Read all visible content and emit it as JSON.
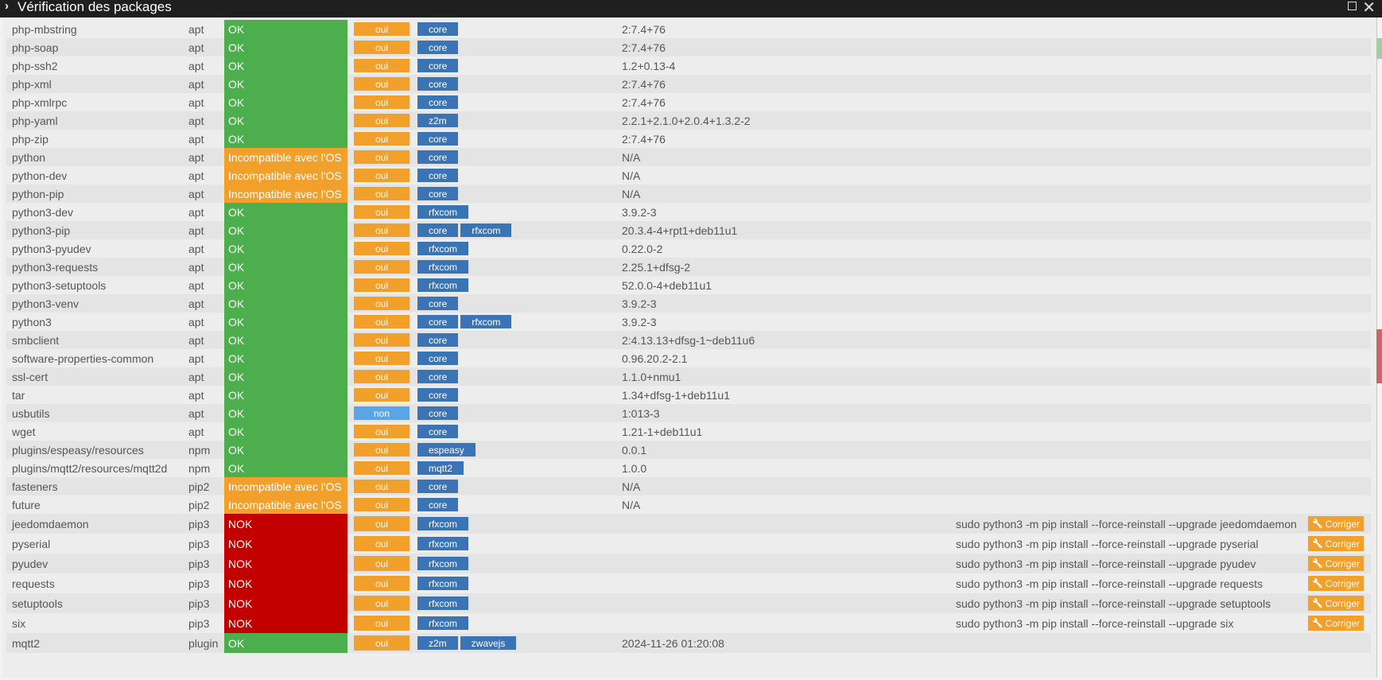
{
  "window": {
    "title": "Vérification des packages"
  },
  "fix_label": "Corriger",
  "colors": {
    "ok": "#4cae4c",
    "warn": "#f0a02b",
    "nok": "#c30000",
    "tag": "#3a74b4",
    "non": "#5aa5e6"
  },
  "rows": [
    {
      "name": "php-mbstring",
      "type": "apt",
      "status": "OK",
      "status_kind": "ok",
      "required": "oui",
      "tags": [
        "core"
      ],
      "version": "2:7.4+76",
      "command": ""
    },
    {
      "name": "php-soap",
      "type": "apt",
      "status": "OK",
      "status_kind": "ok",
      "required": "oui",
      "tags": [
        "core"
      ],
      "version": "2:7.4+76",
      "command": ""
    },
    {
      "name": "php-ssh2",
      "type": "apt",
      "status": "OK",
      "status_kind": "ok",
      "required": "oui",
      "tags": [
        "core"
      ],
      "version": "1.2+0.13-4",
      "command": ""
    },
    {
      "name": "php-xml",
      "type": "apt",
      "status": "OK",
      "status_kind": "ok",
      "required": "oui",
      "tags": [
        "core"
      ],
      "version": "2:7.4+76",
      "command": ""
    },
    {
      "name": "php-xmlrpc",
      "type": "apt",
      "status": "OK",
      "status_kind": "ok",
      "required": "oui",
      "tags": [
        "core"
      ],
      "version": "2:7.4+76",
      "command": ""
    },
    {
      "name": "php-yaml",
      "type": "apt",
      "status": "OK",
      "status_kind": "ok",
      "required": "oui",
      "tags": [
        "z2m"
      ],
      "version": "2.2.1+2.1.0+2.0.4+1.3.2-2",
      "command": ""
    },
    {
      "name": "php-zip",
      "type": "apt",
      "status": "OK",
      "status_kind": "ok",
      "required": "oui",
      "tags": [
        "core"
      ],
      "version": "2:7.4+76",
      "command": ""
    },
    {
      "name": "python",
      "type": "apt",
      "status": "Incompatible avec l'OS",
      "status_kind": "warn",
      "required": "oui",
      "tags": [
        "core"
      ],
      "version": "N/A",
      "command": ""
    },
    {
      "name": "python-dev",
      "type": "apt",
      "status": "Incompatible avec l'OS",
      "status_kind": "warn",
      "required": "oui",
      "tags": [
        "core"
      ],
      "version": "N/A",
      "command": ""
    },
    {
      "name": "python-pip",
      "type": "apt",
      "status": "Incompatible avec l'OS",
      "status_kind": "warn",
      "required": "oui",
      "tags": [
        "core"
      ],
      "version": "N/A",
      "command": ""
    },
    {
      "name": "python3-dev",
      "type": "apt",
      "status": "OK",
      "status_kind": "ok",
      "required": "oui",
      "tags": [
        "rfxcom"
      ],
      "version": "3.9.2-3",
      "command": ""
    },
    {
      "name": "python3-pip",
      "type": "apt",
      "status": "OK",
      "status_kind": "ok",
      "required": "oui",
      "tags": [
        "core",
        "rfxcom"
      ],
      "version": "20.3.4-4+rpt1+deb11u1",
      "command": ""
    },
    {
      "name": "python3-pyudev",
      "type": "apt",
      "status": "OK",
      "status_kind": "ok",
      "required": "oui",
      "tags": [
        "rfxcom"
      ],
      "version": "0.22.0-2",
      "command": ""
    },
    {
      "name": "python3-requests",
      "type": "apt",
      "status": "OK",
      "status_kind": "ok",
      "required": "oui",
      "tags": [
        "rfxcom"
      ],
      "version": "2.25.1+dfsg-2",
      "command": ""
    },
    {
      "name": "python3-setuptools",
      "type": "apt",
      "status": "OK",
      "status_kind": "ok",
      "required": "oui",
      "tags": [
        "rfxcom"
      ],
      "version": "52.0.0-4+deb11u1",
      "command": ""
    },
    {
      "name": "python3-venv",
      "type": "apt",
      "status": "OK",
      "status_kind": "ok",
      "required": "oui",
      "tags": [
        "core"
      ],
      "version": "3.9.2-3",
      "command": ""
    },
    {
      "name": "python3",
      "type": "apt",
      "status": "OK",
      "status_kind": "ok",
      "required": "oui",
      "tags": [
        "core",
        "rfxcom"
      ],
      "version": "3.9.2-3",
      "command": ""
    },
    {
      "name": "smbclient",
      "type": "apt",
      "status": "OK",
      "status_kind": "ok",
      "required": "oui",
      "tags": [
        "core"
      ],
      "version": "2:4.13.13+dfsg-1~deb11u6",
      "command": ""
    },
    {
      "name": "software-properties-common",
      "type": "apt",
      "status": "OK",
      "status_kind": "ok",
      "required": "oui",
      "tags": [
        "core"
      ],
      "version": "0.96.20.2-2.1",
      "command": ""
    },
    {
      "name": "ssl-cert",
      "type": "apt",
      "status": "OK",
      "status_kind": "ok",
      "required": "oui",
      "tags": [
        "core"
      ],
      "version": "1.1.0+nmu1",
      "command": ""
    },
    {
      "name": "tar",
      "type": "apt",
      "status": "OK",
      "status_kind": "ok",
      "required": "oui",
      "tags": [
        "core"
      ],
      "version": "1.34+dfsg-1+deb11u1",
      "command": ""
    },
    {
      "name": "usbutils",
      "type": "apt",
      "status": "OK",
      "status_kind": "ok",
      "required": "non",
      "tags": [
        "core"
      ],
      "version": "1:013-3",
      "command": ""
    },
    {
      "name": "wget",
      "type": "apt",
      "status": "OK",
      "status_kind": "ok",
      "required": "oui",
      "tags": [
        "core"
      ],
      "version": "1.21-1+deb11u1",
      "command": ""
    },
    {
      "name": "plugins/espeasy/resources",
      "type": "npm",
      "status": "OK",
      "status_kind": "ok",
      "required": "oui",
      "tags": [
        "espeasy"
      ],
      "version": "0.0.1",
      "command": ""
    },
    {
      "name": "plugins/mqtt2/resources/mqtt2d",
      "type": "npm",
      "status": "OK",
      "status_kind": "ok",
      "required": "oui",
      "tags": [
        "mqtt2"
      ],
      "version": "1.0.0",
      "command": ""
    },
    {
      "name": "fasteners",
      "type": "pip2",
      "status": "Incompatible avec l'OS",
      "status_kind": "warn",
      "required": "oui",
      "tags": [
        "core"
      ],
      "version": "N/A",
      "command": ""
    },
    {
      "name": "future",
      "type": "pip2",
      "status": "Incompatible avec l'OS",
      "status_kind": "warn",
      "required": "oui",
      "tags": [
        "core"
      ],
      "version": "N/A",
      "command": ""
    },
    {
      "name": "jeedomdaemon",
      "type": "pip3",
      "status": "NOK",
      "status_kind": "nok",
      "required": "oui",
      "tags": [
        "rfxcom"
      ],
      "version": "",
      "command": "sudo python3 -m pip install --force-reinstall --upgrade jeedomdaemon"
    },
    {
      "name": "pyserial",
      "type": "pip3",
      "status": "NOK",
      "status_kind": "nok",
      "required": "oui",
      "tags": [
        "rfxcom"
      ],
      "version": "",
      "command": "sudo python3 -m pip install --force-reinstall --upgrade pyserial"
    },
    {
      "name": "pyudev",
      "type": "pip3",
      "status": "NOK",
      "status_kind": "nok",
      "required": "oui",
      "tags": [
        "rfxcom"
      ],
      "version": "",
      "command": "sudo python3 -m pip install --force-reinstall --upgrade pyudev"
    },
    {
      "name": "requests",
      "type": "pip3",
      "status": "NOK",
      "status_kind": "nok",
      "required": "oui",
      "tags": [
        "rfxcom"
      ],
      "version": "",
      "command": "sudo python3 -m pip install --force-reinstall --upgrade requests"
    },
    {
      "name": "setuptools",
      "type": "pip3",
      "status": "NOK",
      "status_kind": "nok",
      "required": "oui",
      "tags": [
        "rfxcom"
      ],
      "version": "",
      "command": "sudo python3 -m pip install --force-reinstall --upgrade setuptools"
    },
    {
      "name": "six",
      "type": "pip3",
      "status": "NOK",
      "status_kind": "nok",
      "required": "oui",
      "tags": [
        "rfxcom"
      ],
      "version": "",
      "command": "sudo python3 -m pip install --force-reinstall --upgrade six"
    },
    {
      "name": "mqtt2",
      "type": "plugin",
      "status": "OK",
      "status_kind": "ok",
      "required": "oui",
      "tags": [
        "z2m",
        "zwavejs"
      ],
      "version": "2024-11-26 01:20:08",
      "command": ""
    }
  ]
}
